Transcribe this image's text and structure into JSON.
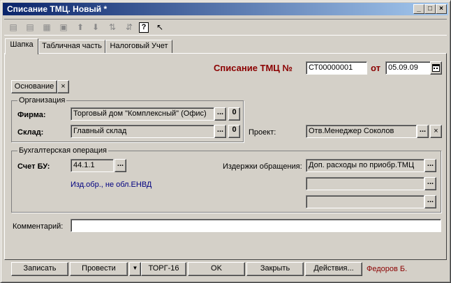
{
  "window": {
    "title": "Списание ТМЦ. Новый *",
    "min": "_",
    "max": "□",
    "close": "×"
  },
  "toolbar": {
    "icons": [
      "add-row-icon",
      "copy-row-icon",
      "delete-row-icon",
      "edit-row-icon",
      "move-up-icon",
      "move-down-icon",
      "sort-asc-icon",
      "sort-desc-icon",
      "help-icon",
      "context-help-icon"
    ],
    "help_glyph": "?"
  },
  "tabs": [
    "Шапка",
    "Табличная часть",
    "Налоговый Учет"
  ],
  "header": {
    "doc_title": "Списание ТМЦ №",
    "number": "СТ00000001",
    "from_label": "от",
    "date": "05.09.09"
  },
  "basis": {
    "label": "Основание",
    "clear": "×"
  },
  "org": {
    "group": "Организация",
    "firm_label": "Фирма:",
    "firm": "Торговый дом \"Комплексный\" (Офис)",
    "warehouse_label": "Склад:",
    "warehouse": "Главный склад",
    "dots": "...",
    "zero": "0"
  },
  "project": {
    "label": "Проект:",
    "value": "Отв.Менеджер Соколов",
    "clear": "×"
  },
  "accounting": {
    "group": "Бухгалтерская операция",
    "account_label": "Счет БУ:",
    "account": "44.1.1",
    "account_desc": "Изд.обр., не обл.ЕНВД",
    "costs_label": "Издержки обращения:",
    "costs": "Доп. расходы по приобр.ТМЦ",
    "costs2": "",
    "costs3": ""
  },
  "comment": {
    "label": "Комментарий:",
    "value": ""
  },
  "buttons": {
    "write": "Записать",
    "post": "Провести",
    "arrow": "▼",
    "torg": "ТОРГ-16",
    "ok": "OK",
    "close": "Закрыть",
    "actions": "Действия..."
  },
  "user": "Федоров Б.",
  "colors": {
    "title_start": "#0a246a",
    "title_end": "#a6caf0",
    "doc_title": "#8b0000",
    "desc": "#000080",
    "user": "#8b0000"
  }
}
